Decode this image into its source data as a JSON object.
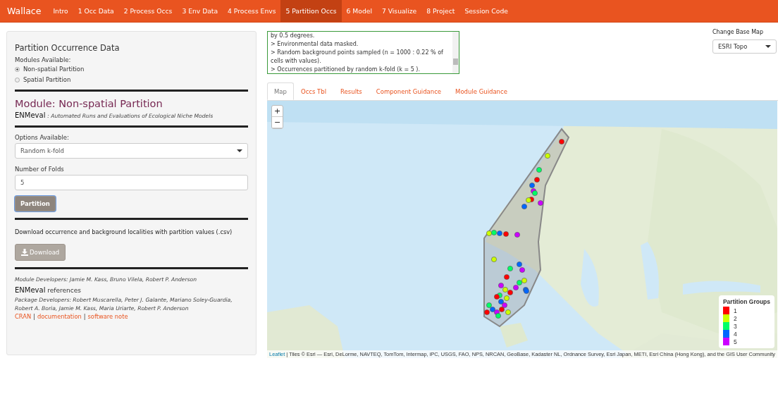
{
  "navbar": {
    "brand": "Wallace",
    "items": [
      {
        "label": "Intro",
        "selected": false
      },
      {
        "label": "1 Occ Data",
        "selected": false
      },
      {
        "label": "2 Process Occs",
        "selected": false
      },
      {
        "label": "3 Env Data",
        "selected": false
      },
      {
        "label": "4 Process Envs",
        "selected": false
      },
      {
        "label": "5 Partition Occs",
        "selected": true
      },
      {
        "label": "6 Model",
        "selected": false
      },
      {
        "label": "7 Visualize",
        "selected": false
      },
      {
        "label": "8 Project",
        "selected": false
      },
      {
        "label": "Session Code",
        "selected": false
      }
    ]
  },
  "sidebar": {
    "title": "Partition Occurrence Data",
    "modules_label": "Modules Available:",
    "modules": [
      {
        "label": "Non-spatial Partition",
        "selected": true
      },
      {
        "label": "Spatial Partition",
        "selected": false
      }
    ],
    "module_title": "Module: Non-spatial Partition",
    "package": "ENMeval",
    "package_desc": ": Automated Runs and Evaluations of Ecological Niche Models",
    "options_label": "Options Available:",
    "options_value": "Random k-fold",
    "folds_label": "Number of Folds",
    "folds_value": "5",
    "partition_button": "Partition",
    "download_text": "Download occurrence and background localities with partition values (.csv)",
    "download_button": "Download",
    "module_devs": "Module Developers: Jamie M. Kass, Bruno Vilela, Robert P. Anderson",
    "references_package": "ENMeval",
    "references_label": "references",
    "package_devs": "Package Developers: Robert Muscarella, Peter J. Galante, Mariano Soley-Guardia, Robert A. Boria, Jamie M. Kass, Maria Uriarte, Robert P. Anderson",
    "links": [
      "CRAN",
      "documentation",
      "software note"
    ],
    "link_separator": "|"
  },
  "log": [
    "by 0.5 degrees.",
    "> Environmental data masked.",
    "> Random background points sampled (n = 1000 : 0.22 % of cells with values).",
    "> Occurrences partitioned by random k-fold (k = 5 )."
  ],
  "basemap": {
    "label": "Change Base Map",
    "value": "ESRI Topo"
  },
  "tabs": [
    {
      "label": "Map",
      "selected": true
    },
    {
      "label": "Occs Tbl",
      "selected": false
    },
    {
      "label": "Results",
      "selected": false
    },
    {
      "label": "Component Guidance",
      "selected": false
    },
    {
      "label": "Module Guidance",
      "selected": false
    }
  ],
  "map": {
    "kind": "picture",
    "zoom_in": "+",
    "zoom_out": "−",
    "legend": {
      "title": "Partition Groups",
      "items": [
        {
          "label": "1",
          "color": "#ff0000"
        },
        {
          "label": "2",
          "color": "#ccff00"
        },
        {
          "label": "3",
          "color": "#00ff66"
        },
        {
          "label": "4",
          "color": "#0066ff"
        },
        {
          "label": "5",
          "color": "#cc00ff"
        }
      ]
    },
    "attribution_link": "Leaflet",
    "attribution": "| Tiles © Esri — Esri, DeLorme, NAVTEQ, TomTom, Intermap, iPC, USGS, FAO, NPS, NRCAN, GeoBase, Kadaster NL, Ordnance Survey, Esri Japan, METI, Esri China (Hong Kong), and the GIS User Community"
  }
}
